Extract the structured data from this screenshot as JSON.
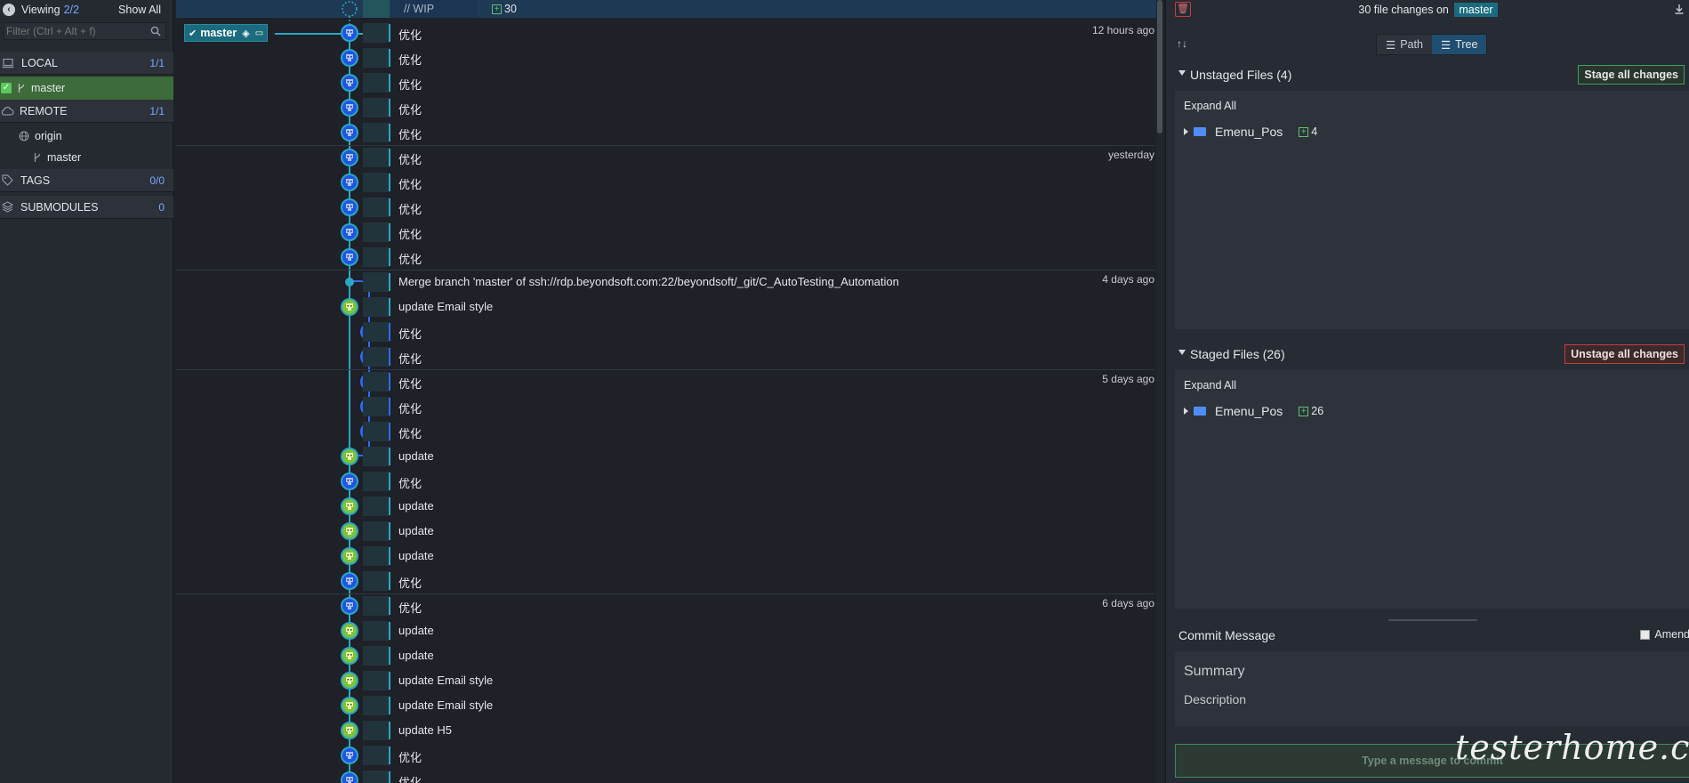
{
  "left": {
    "viewing_label": "Viewing",
    "viewing_count": "2/2",
    "show_all": "Show All",
    "filter_placeholder": "Filter (Ctrl + Alt + f)",
    "local": {
      "label": "LOCAL",
      "count": "1/1",
      "branch": "master"
    },
    "remote": {
      "label": "REMOTE",
      "count": "1/1",
      "remote_name": "origin",
      "branch": "master"
    },
    "tags": {
      "label": "TAGS",
      "count": "0/0"
    },
    "submodules": {
      "label": "SUBMODULES",
      "count": "0"
    }
  },
  "graph": {
    "wip_label": "// WIP",
    "wip_count": "30",
    "branch_tag": "master",
    "rows": [
      {
        "msg": "优化",
        "ts": "12 hours ago"
      },
      {
        "msg": "优化",
        "ts": ""
      },
      {
        "msg": "优化",
        "ts": ""
      },
      {
        "msg": "优化",
        "ts": ""
      },
      {
        "msg": "优化",
        "ts": ""
      },
      {
        "msg": "优化",
        "ts": "yesterday"
      },
      {
        "msg": "优化",
        "ts": ""
      },
      {
        "msg": "优化",
        "ts": ""
      },
      {
        "msg": "优化",
        "ts": ""
      },
      {
        "msg": "优化",
        "ts": ""
      },
      {
        "msg": "Merge branch 'master' of ssh://rdp.beyondsoft.com:22/beyondsoft/_git/C_AutoTesting_Automation",
        "ts": "4 days ago"
      },
      {
        "msg": "update Email style",
        "ts": ""
      },
      {
        "msg": "优化",
        "ts": ""
      },
      {
        "msg": "优化",
        "ts": ""
      },
      {
        "msg": "优化",
        "ts": "5 days ago"
      },
      {
        "msg": "优化",
        "ts": ""
      },
      {
        "msg": "优化",
        "ts": ""
      },
      {
        "msg": "update",
        "ts": ""
      },
      {
        "msg": "优化",
        "ts": ""
      },
      {
        "msg": "update",
        "ts": ""
      },
      {
        "msg": "update",
        "ts": ""
      },
      {
        "msg": "update",
        "ts": ""
      },
      {
        "msg": "优化",
        "ts": ""
      },
      {
        "msg": "优化",
        "ts": "6 days ago"
      },
      {
        "msg": "update",
        "ts": ""
      },
      {
        "msg": "update",
        "ts": ""
      },
      {
        "msg": "update Email style",
        "ts": ""
      },
      {
        "msg": "update Email style",
        "ts": ""
      },
      {
        "msg": "update H5",
        "ts": ""
      },
      {
        "msg": "优化",
        "ts": ""
      },
      {
        "msg": "优化",
        "ts": ""
      }
    ]
  },
  "right": {
    "changes_text": "30 file changes on",
    "branch": "master",
    "view_path": "Path",
    "view_tree": "Tree",
    "unstaged": {
      "title": "Unstaged Files (4)",
      "button": "Stage all changes",
      "expand": "Expand All",
      "folder": "Emenu_Pos",
      "count": "4"
    },
    "staged": {
      "title": "Staged Files (26)",
      "button": "Unstage all changes",
      "expand": "Expand All",
      "folder": "Emenu_Pos",
      "count": "26"
    },
    "commit": {
      "title": "Commit Message",
      "amend": "Amend",
      "summary_placeholder": "Summary",
      "description_placeholder": "Description",
      "commit_button": "Type a message to commit"
    }
  },
  "watermark": "testerhome.com",
  "colors": {
    "accent": "#1b6b7e",
    "local_active": "#3d6b3a",
    "blue_node": "#2f6bff",
    "green_node": "#9bd53a",
    "stage_green": "#3ea05a",
    "unstage_red": "#c43c3c"
  }
}
